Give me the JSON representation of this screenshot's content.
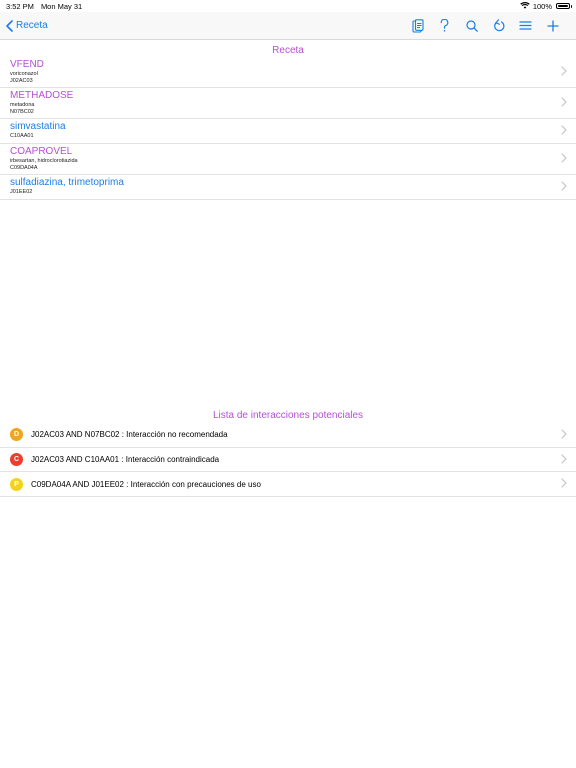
{
  "status": {
    "time": "3:52 PM",
    "date": "Mon May 31",
    "battery": "100%"
  },
  "nav": {
    "back_label": "Receta",
    "icons": [
      "clipboard-icon",
      "help-icon",
      "search-icon",
      "undo-icon",
      "menu-icon",
      "add-icon"
    ]
  },
  "receta": {
    "title": "Receta",
    "items": [
      {
        "name": "VFEND",
        "lines": [
          "voriconazol",
          "J02AC03"
        ],
        "color": "#b44fd9"
      },
      {
        "name": "METHADOSE",
        "lines": [
          "metadona",
          "N07BC02"
        ],
        "color": "#b44fd9"
      },
      {
        "name": "simvastatina",
        "lines": [
          "C10AA01"
        ],
        "color": "#1a7ee6"
      },
      {
        "name": "COAPROVEL",
        "lines": [
          "irbesartan, hidroclorotiazida",
          "C09DA04A"
        ],
        "color": "#b44fd9"
      },
      {
        "name": "sulfadiazina, trimetoprima",
        "lines": [
          "J01EE02"
        ],
        "color": "#1a7ee6"
      }
    ]
  },
  "interacciones": {
    "title": "Lista de interacciones potenciales",
    "items": [
      {
        "badge": "D",
        "color": "#f0a51c",
        "text": "J02AC03 AND N07BC02 : Interacción no recomendada"
      },
      {
        "badge": "C",
        "color": "#e9402f",
        "text": "J02AC03 AND C10AA01 : Interacción contraindicada"
      },
      {
        "badge": "P",
        "color": "#f5d21a",
        "text": "C09DA04A AND J01EE02 : Interacción con precauciones de uso"
      }
    ]
  }
}
